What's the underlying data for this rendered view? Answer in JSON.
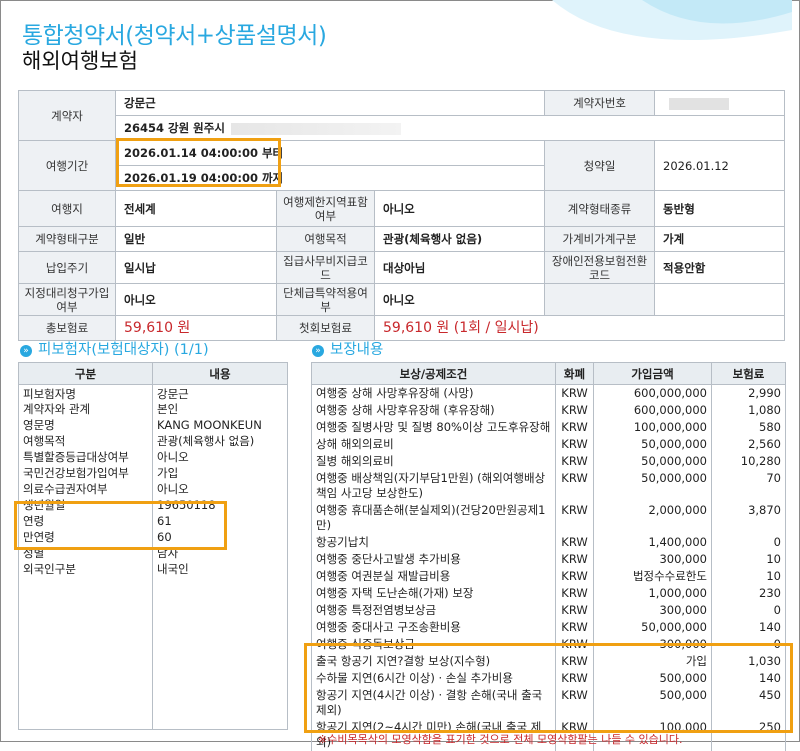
{
  "header": {
    "title": "통합청약서(청약서+상품설명서)",
    "subtitle": "해외여행보험"
  },
  "contract": {
    "contractor_label": "계약자",
    "contractor_name": "강문근",
    "contractor_no_label": "계약자번호",
    "address": "26454 강원 원주시",
    "period_label": "여행기간",
    "period_start": "2026.01.14 04:00:00 부터",
    "period_end": "2026.01.19 04:00:00 까지",
    "apply_date_label": "청약일",
    "apply_date": "2026.01.12",
    "destination_label": "여행지",
    "destination": "전세계",
    "restricted_label": "여행제한지역표함여부",
    "restricted": "아니오",
    "contract_type_label": "계약형태종류",
    "contract_type": "동반형",
    "contract_class_label": "계약형태구분",
    "contract_class": "일반",
    "purpose_label": "여행목적",
    "purpose": "관광(체육행사 없음)",
    "family_class_label": "가계비가계구분",
    "family_class": "가계",
    "pay_cycle_label": "납입주기",
    "pay_cycle": "일시납",
    "group_code_label": "집급사무비지급코드",
    "group_code": "대상아님",
    "disabled_label": "장애인전용보험전환코드",
    "disabled": "적용안함",
    "agent_label": "지정대리청구가입여부",
    "agent": "아니오",
    "group_special_label": "단체급특약적용여부",
    "group_special": "아니오",
    "total_premium_label": "총보험료",
    "total_premium": "59,610 원",
    "first_premium_label": "첫회보험료",
    "first_premium": "59,610 원 (1회 / 일시납)"
  },
  "insured": {
    "section_title": "피보험자(보험대상자) (1/1)",
    "col_item": "구분",
    "col_content": "내용",
    "rows": [
      {
        "label": "피보험자명",
        "value": "강문근"
      },
      {
        "label": "계약자와 관계",
        "value": "본인"
      },
      {
        "label": "영문명",
        "value": "KANG MOONKEUN"
      },
      {
        "label": "여행목적",
        "value": "관광(체육행사 없음)"
      },
      {
        "label": "특별할증등급대상여부",
        "value": "아니오"
      },
      {
        "label": "국민건강보험가입여부",
        "value": "가입"
      },
      {
        "label": "의료수급권자여부",
        "value": "아니오"
      },
      {
        "label": "생년월일",
        "value": "19650118"
      },
      {
        "label": "연령",
        "value": "61"
      },
      {
        "label": "만연령",
        "value": "60"
      },
      {
        "label": "성별",
        "value": "남자"
      },
      {
        "label": "외국인구분",
        "value": "내국인"
      }
    ]
  },
  "coverage": {
    "section_title": "보장내용",
    "col_name": "보상/공제조건",
    "col_currency": "화폐",
    "col_amount": "가입금액",
    "col_premium": "보험료",
    "rows": [
      {
        "name": "여행중 상해 사망후유장해 (사망)",
        "currency": "KRW",
        "amount": "600,000,000",
        "premium": "2,990"
      },
      {
        "name": "여행중 상해 사망후유장해 (후유장해)",
        "currency": "KRW",
        "amount": "600,000,000",
        "premium": "1,080"
      },
      {
        "name": "여행중 질병사망 및 질병 80%이상 고도후유장해",
        "currency": "KRW",
        "amount": "100,000,000",
        "premium": "580"
      },
      {
        "name": "상해 해외의료비",
        "currency": "KRW",
        "amount": "50,000,000",
        "premium": "2,560"
      },
      {
        "name": "질병 해외의료비",
        "currency": "KRW",
        "amount": "50,000,000",
        "premium": "10,280"
      },
      {
        "name": "여행중 배상책임(자기부담1만원) (해외여행배상책임 사고당 보상한도)",
        "currency": "KRW",
        "amount": "50,000,000",
        "premium": "70"
      },
      {
        "name": "여행중 휴대품손해(분실제외)(건당20만원공제1만)",
        "currency": "KRW",
        "amount": "2,000,000",
        "premium": "3,870"
      },
      {
        "name": "항공기납치",
        "currency": "KRW",
        "amount": "1,400,000",
        "premium": "0"
      },
      {
        "name": "여행중 중단사고발생 추가비용",
        "currency": "KRW",
        "amount": "300,000",
        "premium": "10"
      },
      {
        "name": "여행중 여권분실 재발급비용",
        "currency": "KRW",
        "amount": "법정수수료한도",
        "premium": "10"
      },
      {
        "name": "여행중 자택 도난손해(가재) 보장",
        "currency": "KRW",
        "amount": "1,000,000",
        "premium": "230"
      },
      {
        "name": "여행중 특정전염병보상금",
        "currency": "KRW",
        "amount": "300,000",
        "premium": "0"
      },
      {
        "name": "여행중 중대사고 구조송환비용",
        "currency": "KRW",
        "amount": "50,000,000",
        "premium": "140"
      },
      {
        "name": "여행중 식중독보상금",
        "currency": "KRW",
        "amount": "300,000",
        "premium": "0"
      },
      {
        "name": "출국 항공기 지연?결항 보상(지수형)",
        "currency": "KRW",
        "amount": "가입",
        "premium": "1,030"
      },
      {
        "name": "수하물 지연(6시간 이상) · 손실 추가비용",
        "currency": "KRW",
        "amount": "500,000",
        "premium": "140"
      },
      {
        "name": "항공기 지연(4시간 이상) · 결항 손해(국내 출국 제외)",
        "currency": "KRW",
        "amount": "500,000",
        "premium": "450"
      },
      {
        "name": "항공기 지연(2~4시간 미만) 손해(국내 출국 제외)",
        "currency": "KRW",
        "amount": "100,000",
        "premium": "250"
      }
    ],
    "footnote": "※수비목목삭의 모영삭함을 표기한 것으로 전체 모영삭함팔는 나들 수 있습니다."
  },
  "colors": {
    "accent": "#29a8e0",
    "money": "#c8282c",
    "highlight_orange": "#f0a012",
    "highlight_red": "#d71f28"
  }
}
